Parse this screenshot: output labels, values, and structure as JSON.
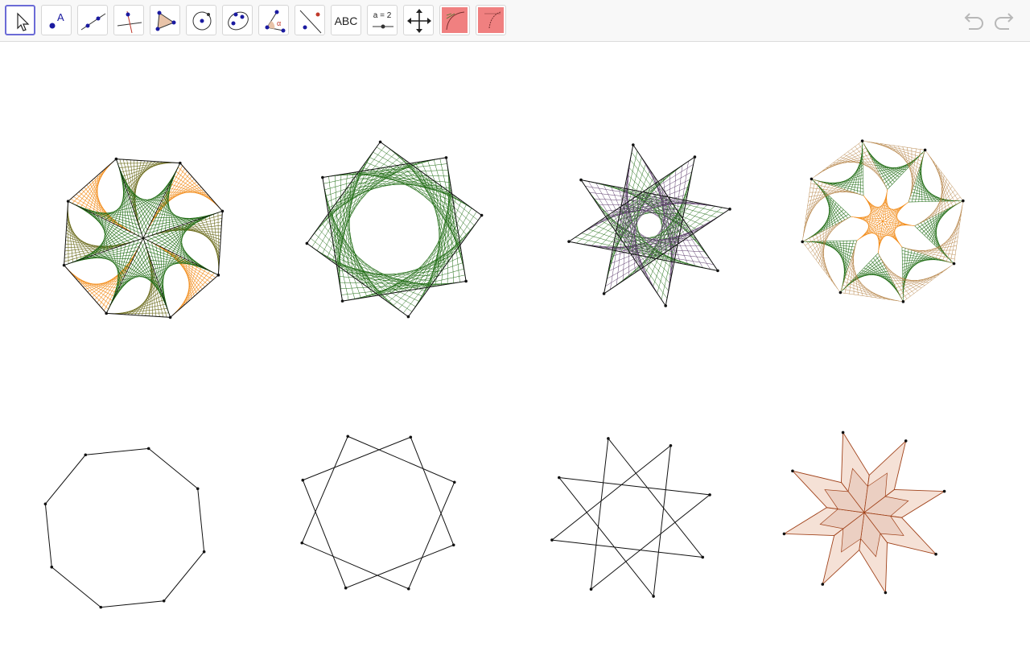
{
  "toolbar": {
    "tools": [
      {
        "name": "move-tool",
        "label": "",
        "selected": true
      },
      {
        "name": "point-tool",
        "label": "A"
      },
      {
        "name": "line-tool",
        "label": ""
      },
      {
        "name": "perpendicular-line-tool",
        "label": ""
      },
      {
        "name": "polygon-tool",
        "label": ""
      },
      {
        "name": "circle-tool",
        "label": ""
      },
      {
        "name": "ellipse-tool",
        "label": ""
      },
      {
        "name": "angle-tool",
        "label": "α"
      },
      {
        "name": "reflect-tool",
        "label": ""
      },
      {
        "name": "text-tool",
        "label": "ABC"
      },
      {
        "name": "slider-tool",
        "label": "a = 2"
      },
      {
        "name": "move-graphics-view-tool",
        "label": ""
      },
      {
        "name": "custom-tool-curve-1",
        "label": ""
      },
      {
        "name": "custom-tool-curve-2",
        "label": ""
      }
    ],
    "undo_icon": "undo-icon",
    "redo_icon": "redo-icon"
  },
  "colors": {
    "green": "#1e6b12",
    "orange": "#f28c1a",
    "olive": "#6a6a1a",
    "purple": "#5b3b6b",
    "tan": "#b07a3a",
    "brown": "#a0421a",
    "tile_fill": "#f5e1d6",
    "tile_fill_dark": "#ebcfc2",
    "selected_border": "#6b6bd6",
    "custom_tool_bg": "#f08080"
  },
  "figures": {
    "top_row": [
      "octagon-curve-stitching",
      "octagram-8-3-curve-stitching",
      "octagram-8-3-star-curve-stitching",
      "eight-point-star-curve-stitching"
    ],
    "bottom_row": [
      "regular-octagon",
      "octagram-8-2",
      "octagram-8-3",
      "eight-point-star-tiling"
    ]
  }
}
